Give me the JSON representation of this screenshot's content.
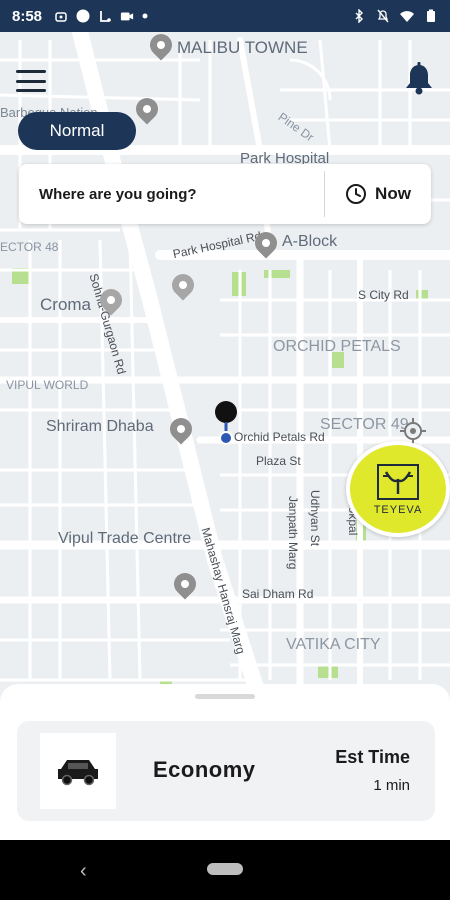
{
  "status_bar": {
    "time": "8:58",
    "left_icons": [
      "android-icon",
      "circle-icon",
      "usb-icon",
      "video-icon",
      "dot-icon"
    ],
    "right_icons": [
      "bluetooth-icon",
      "mute-icon",
      "wifi-icon",
      "battery-icon"
    ]
  },
  "map": {
    "labels": {
      "malibu": "MALIBU TOWNE",
      "barbeque": "Barbeque Nation",
      "pine": "Pine Dr",
      "park_hospital": "Park Hospital",
      "sector48": "ECTOR 48",
      "park_hospital_road": "Park Hospital Rd",
      "a_block": "A-Block",
      "gurgaon_rd": "Sohna-Gurgaon Rd",
      "croma": "Croma",
      "s_city": "S City Rd",
      "orchid_petals": "ORCHID PETALS",
      "vipul_world": "VIPUL WORLD",
      "shriram": "Shriram Dhaba",
      "orchid_rd": "Orchid Petals Rd",
      "sector49": "SECTOR 49",
      "plaza": "Plaza St",
      "vipul_trade": "Vipul Trade Centre",
      "janpath": "Janpath Marg",
      "udhyan": "Udhyan St",
      "lokpal": "Lokpal",
      "mahashay": "Mahashay Hansraj Marg",
      "sai_dham": "Sai Dham Rd",
      "vatika": "VATIKA CITY"
    }
  },
  "header": {
    "menu_icon": "hamburger-menu-icon",
    "notification_icon": "bell-icon",
    "mode_label": "Normal"
  },
  "search": {
    "placeholder": "Where are you going?",
    "time_label": "Now",
    "time_icon": "clock-icon"
  },
  "brand": {
    "logo_text": "TEYEVA"
  },
  "ride": {
    "name": "Economy",
    "est_label": "Est Time",
    "est_value": "1 min",
    "car_icon": "car-icon"
  },
  "nav": {
    "back_icon": "back-chevron-icon",
    "home_icon": "home-pill-icon"
  },
  "colors": {
    "primary": "#1d3557",
    "accent": "#dfe82a",
    "map_bg": "#eceff1",
    "park_green": "#b6e08f"
  }
}
